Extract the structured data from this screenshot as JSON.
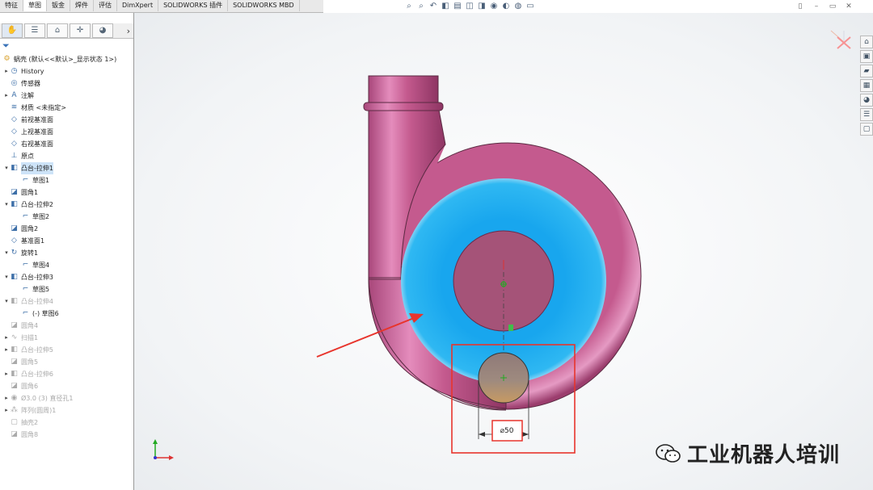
{
  "toolbar": {
    "tabs": [
      "特征",
      "草图",
      "钣金",
      "焊件",
      "评估",
      "DimXpert",
      "SOLIDWORKS 插件",
      "SOLIDWORKS MBD"
    ],
    "active_tab": 1
  },
  "feature_manager": {
    "tab_icons": [
      "✋",
      "☰",
      "⌂",
      "✛",
      "◕"
    ],
    "expand_arrow": "›",
    "root": "蜗壳 (默认<<默认>_显示状态 1>)",
    "items": [
      {
        "label": "History",
        "icon": "history-icon",
        "expand": "▸",
        "level": 1
      },
      {
        "label": "传感器",
        "icon": "sensor-icon",
        "expand": "",
        "level": 1
      },
      {
        "label": "注解",
        "icon": "annotation-icon",
        "expand": "▸",
        "level": 1
      },
      {
        "label": "材质 <未指定>",
        "icon": "material-icon",
        "expand": "",
        "level": 1
      },
      {
        "label": "前视基准面",
        "icon": "plane-icon",
        "expand": "",
        "level": 1
      },
      {
        "label": "上视基准面",
        "icon": "plane-icon",
        "expand": "",
        "level": 1
      },
      {
        "label": "右视基准面",
        "icon": "plane-icon",
        "expand": "",
        "level": 1
      },
      {
        "label": "原点",
        "icon": "origin-icon",
        "expand": "",
        "level": 1
      },
      {
        "label": "凸台-拉伸1",
        "icon": "extrude-icon",
        "expand": "▾",
        "level": 1,
        "selected": true
      },
      {
        "label": "草图1",
        "icon": "sketch-icon",
        "expand": "",
        "level": 2
      },
      {
        "label": "圆角1",
        "icon": "fillet-icon",
        "expand": "",
        "level": 1
      },
      {
        "label": "凸台-拉伸2",
        "icon": "extrude-icon",
        "expand": "▾",
        "level": 1
      },
      {
        "label": "草图2",
        "icon": "sketch-icon",
        "expand": "",
        "level": 2
      },
      {
        "label": "圆角2",
        "icon": "fillet-icon",
        "expand": "",
        "level": 1
      },
      {
        "label": "基准面1",
        "icon": "plane-icon",
        "expand": "",
        "level": 1
      },
      {
        "label": "旋转1",
        "icon": "revolve-icon",
        "expand": "▾",
        "level": 1
      },
      {
        "label": "草图4",
        "icon": "sketch-icon",
        "expand": "",
        "level": 2
      },
      {
        "label": "凸台-拉伸3",
        "icon": "extrude-icon",
        "expand": "▾",
        "level": 1
      },
      {
        "label": "草图5",
        "icon": "sketch-icon",
        "expand": "",
        "level": 2
      },
      {
        "label": "凸台-拉伸4",
        "icon": "extrude-icon",
        "expand": "▾",
        "level": 1,
        "disabled": true
      },
      {
        "label": "(-) 草图6",
        "icon": "sketch-icon",
        "expand": "",
        "level": 2
      },
      {
        "label": "圆角4",
        "icon": "fillet-icon",
        "expand": "",
        "level": 1,
        "disabled": true
      },
      {
        "label": "扫描1",
        "icon": "sweep-icon",
        "expand": "▸",
        "level": 1,
        "disabled": true
      },
      {
        "label": "凸台-拉伸5",
        "icon": "extrude-icon",
        "expand": "▸",
        "level": 1,
        "disabled": true
      },
      {
        "label": "圆角5",
        "icon": "fillet-icon",
        "expand": "",
        "level": 1,
        "disabled": true
      },
      {
        "label": "凸台-拉伸6",
        "icon": "extrude-icon",
        "expand": "▸",
        "level": 1,
        "disabled": true
      },
      {
        "label": "圆角6",
        "icon": "fillet-icon",
        "expand": "",
        "level": 1,
        "disabled": true
      },
      {
        "label": "Ø3.0 (3) 直径孔1",
        "icon": "hole-icon",
        "expand": "▸",
        "level": 1,
        "disabled": true
      },
      {
        "label": "阵列(圆周)1",
        "icon": "pattern-icon",
        "expand": "▸",
        "level": 1,
        "disabled": true
      },
      {
        "label": "抽壳2",
        "icon": "shell-icon",
        "expand": "",
        "level": 1,
        "disabled": true
      },
      {
        "label": "圆角8",
        "icon": "fillet-icon",
        "expand": "",
        "level": 1,
        "disabled": true
      }
    ]
  },
  "viewport": {
    "dimension_text": "⌀50",
    "colors": {
      "part": "#c45a8e",
      "sketch_region": "#1ea8ee",
      "highlight": "#e8342c",
      "dimension_box": "#e8342c"
    }
  },
  "heads_up_icons": [
    "zoom-fit-icon",
    "zoom-area-icon",
    "previous-view-icon",
    "section-view-icon",
    "dynamic-annotation-icon",
    "view-orientation-icon",
    "display-style-icon",
    "hide-show-icon",
    "edit-appearance-icon",
    "apply-scene-icon",
    "view-settings-icon"
  ],
  "right_tools": [
    "home-icon",
    "part-icon",
    "folder-icon",
    "palette-icon",
    "appearance-icon",
    "custom-properties-icon",
    "forum-icon"
  ],
  "watermark": {
    "text": "工业机器人培训",
    "icon": "wechat-icon"
  }
}
